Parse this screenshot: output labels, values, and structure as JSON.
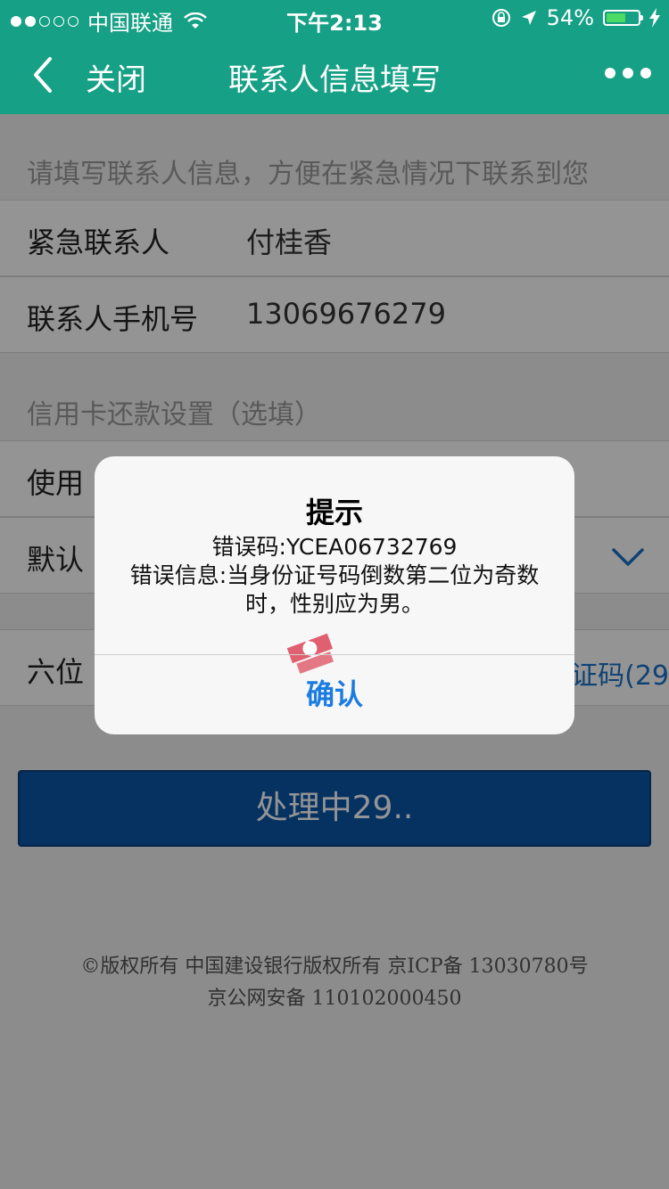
{
  "status_bar": {
    "carrier": "中国联通",
    "time": "下午2:13",
    "battery": "54%"
  },
  "nav": {
    "close_label": "关闭",
    "title": "联系人信息填写"
  },
  "contact_section": {
    "hint": "请填写联系人信息，方便在紧急情况下联系到您",
    "emergency_contact_label": "紧急联系人",
    "emergency_contact_value": "付桂香",
    "phone_label": "联系人手机号",
    "phone_value": "13069676279"
  },
  "credit_section": {
    "hint": "信用卡还款设置（选填）",
    "use_label_partial": "使用",
    "default_label_partial": "默认",
    "code_label_partial": "六位",
    "code_link_partial": "证码(29"
  },
  "submit_button": "处理中29..",
  "footer": {
    "line1": "©版权所有 中国建设银行版权所有 京ICP备 13030780号",
    "line2": "京公网安备 110102000450"
  },
  "dialog": {
    "title": "提示",
    "error_code": "错误码:YCEA06732769",
    "error_message": "错误信息:当身份证号码倒数第二位为奇数时，性别应为男。",
    "confirm": "确认"
  }
}
